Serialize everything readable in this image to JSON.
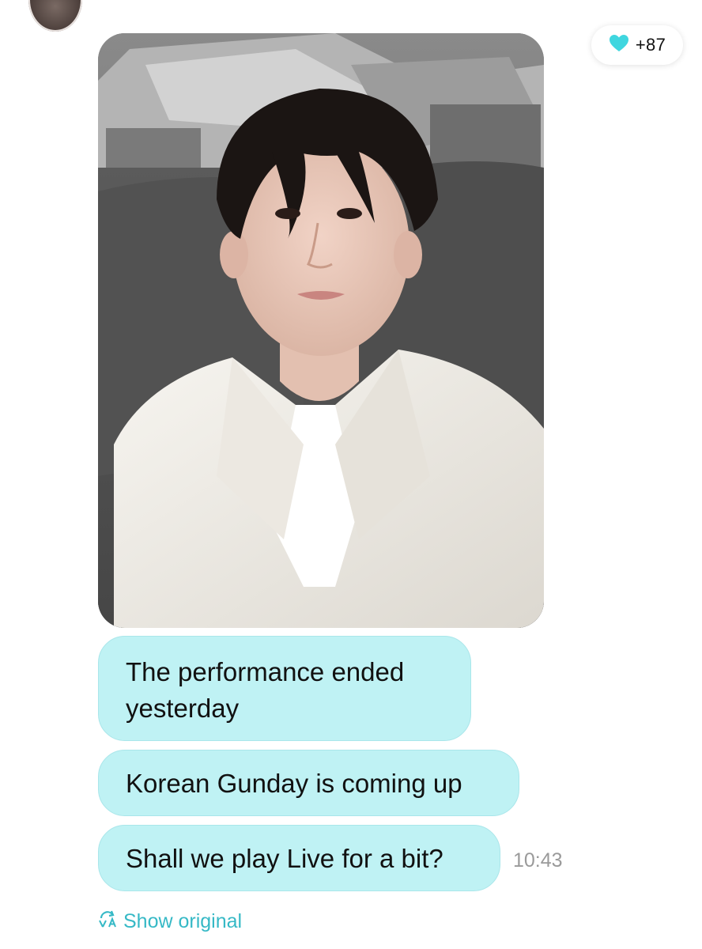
{
  "chat": {
    "avatar_icon": "user-avatar",
    "reaction": {
      "icon": "heart-icon",
      "color": "#3fd6df",
      "count": "+87"
    },
    "messages": [
      {
        "text": "The performance ended yesterday"
      },
      {
        "text": "Korean Gunday is coming up"
      },
      {
        "text": "Shall we play Live for a bit?"
      }
    ],
    "timestamp": "10:43",
    "show_original": {
      "icon": "translate-icon",
      "label": "Show original",
      "color": "#36b9c6"
    },
    "bubble_color": "#bff2f4"
  }
}
